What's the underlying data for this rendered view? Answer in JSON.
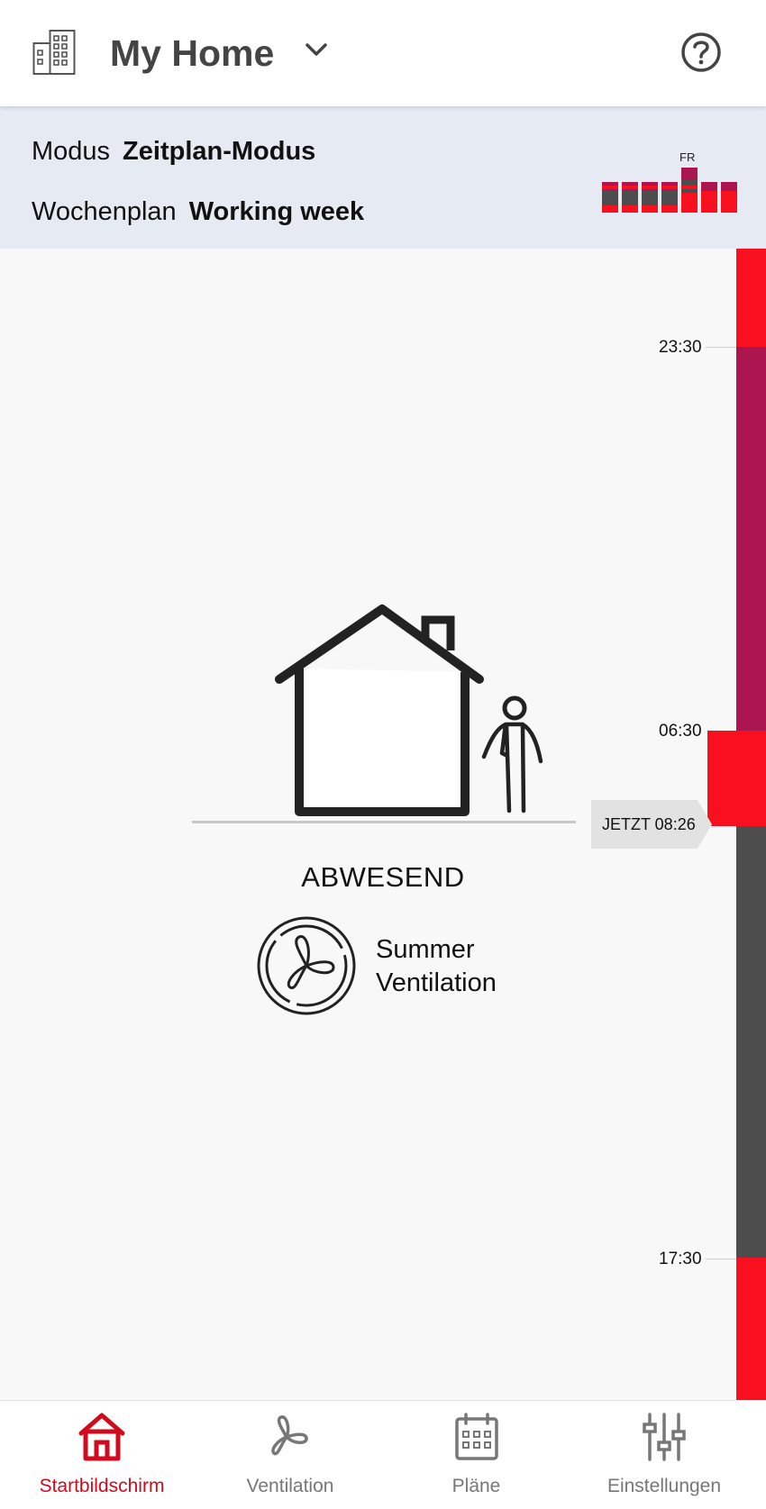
{
  "header": {
    "title": "My Home",
    "building_icon": "building-icon",
    "dropdown_icon": "chevron-down-icon",
    "help_icon": "help-circle-icon"
  },
  "mode": {
    "mode_label": "Modus",
    "mode_value": "Zeitplan-Modus",
    "schedule_label": "Wochenplan",
    "schedule_value": "Working week",
    "current_day": "FR"
  },
  "timeline": {
    "times": [
      "23:30",
      "06:30",
      "17:30"
    ],
    "now_label": "JETZT 08:26",
    "colors": {
      "red": "#f9101e",
      "purple": "#ab1650",
      "gray": "#4d4d4d"
    }
  },
  "status": {
    "presence": "ABWESEND",
    "ventilation_line1": "Summer",
    "ventilation_line2": "Ventilation",
    "icon": "fan-icon"
  },
  "nav": {
    "items": [
      {
        "label": "Startbildschirm",
        "icon": "home-icon",
        "active": true
      },
      {
        "label": "Ventilation",
        "icon": "fan-icon",
        "active": false
      },
      {
        "label": "Pläne",
        "icon": "calendar-icon",
        "active": false
      },
      {
        "label": "Einstellungen",
        "icon": "sliders-icon",
        "active": false
      }
    ],
    "active_color": "#d10a1d",
    "inactive_color": "#777777"
  }
}
